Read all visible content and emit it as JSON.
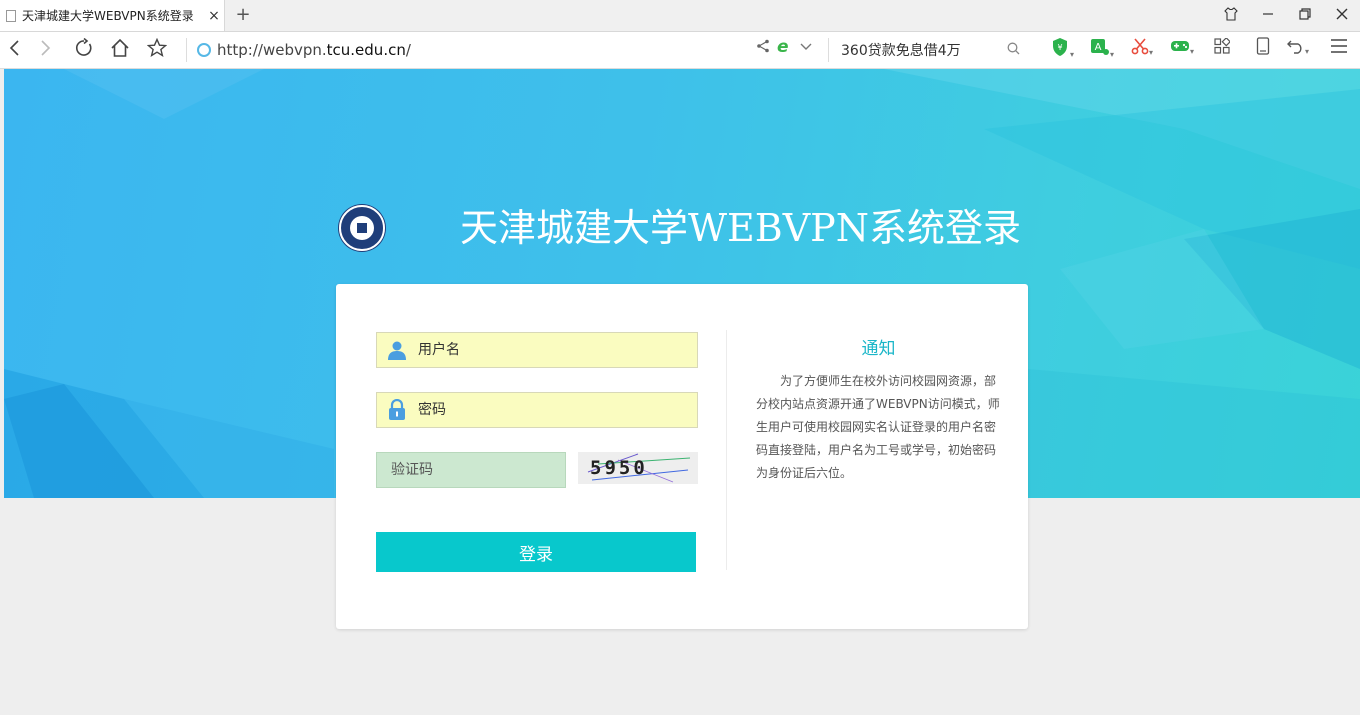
{
  "browser": {
    "tab_title": "天津城建大学WEBVPN系统登录",
    "tab_close": "×",
    "new_tab": "+",
    "url_prefix": "http://webvpn.",
    "url_domain": "tcu.edu.cn",
    "url_suffix": "/",
    "search_text": "360贷款免息借4万",
    "accent_color": "#3ab54a"
  },
  "banner": {
    "title": "天津城建大学WEBVPN系统登录",
    "gradient_start": "#3bb6f0",
    "gradient_end": "#3ad3d8"
  },
  "login": {
    "username_placeholder": "用户名",
    "password_placeholder": "密码",
    "captcha_placeholder": "验证码",
    "captcha_code": "5950",
    "submit_label": "登录",
    "button_color": "#08c8cc"
  },
  "notice": {
    "title": "通知",
    "body": "为了方便师生在校外访问校园网资源，部分校内站点资源开通了WEBVPN访问模式，师生用户可使用校园网实名认证登录的用户名密码直接登陆，用户名为工号或学号，初始密码为身份证后六位。"
  }
}
